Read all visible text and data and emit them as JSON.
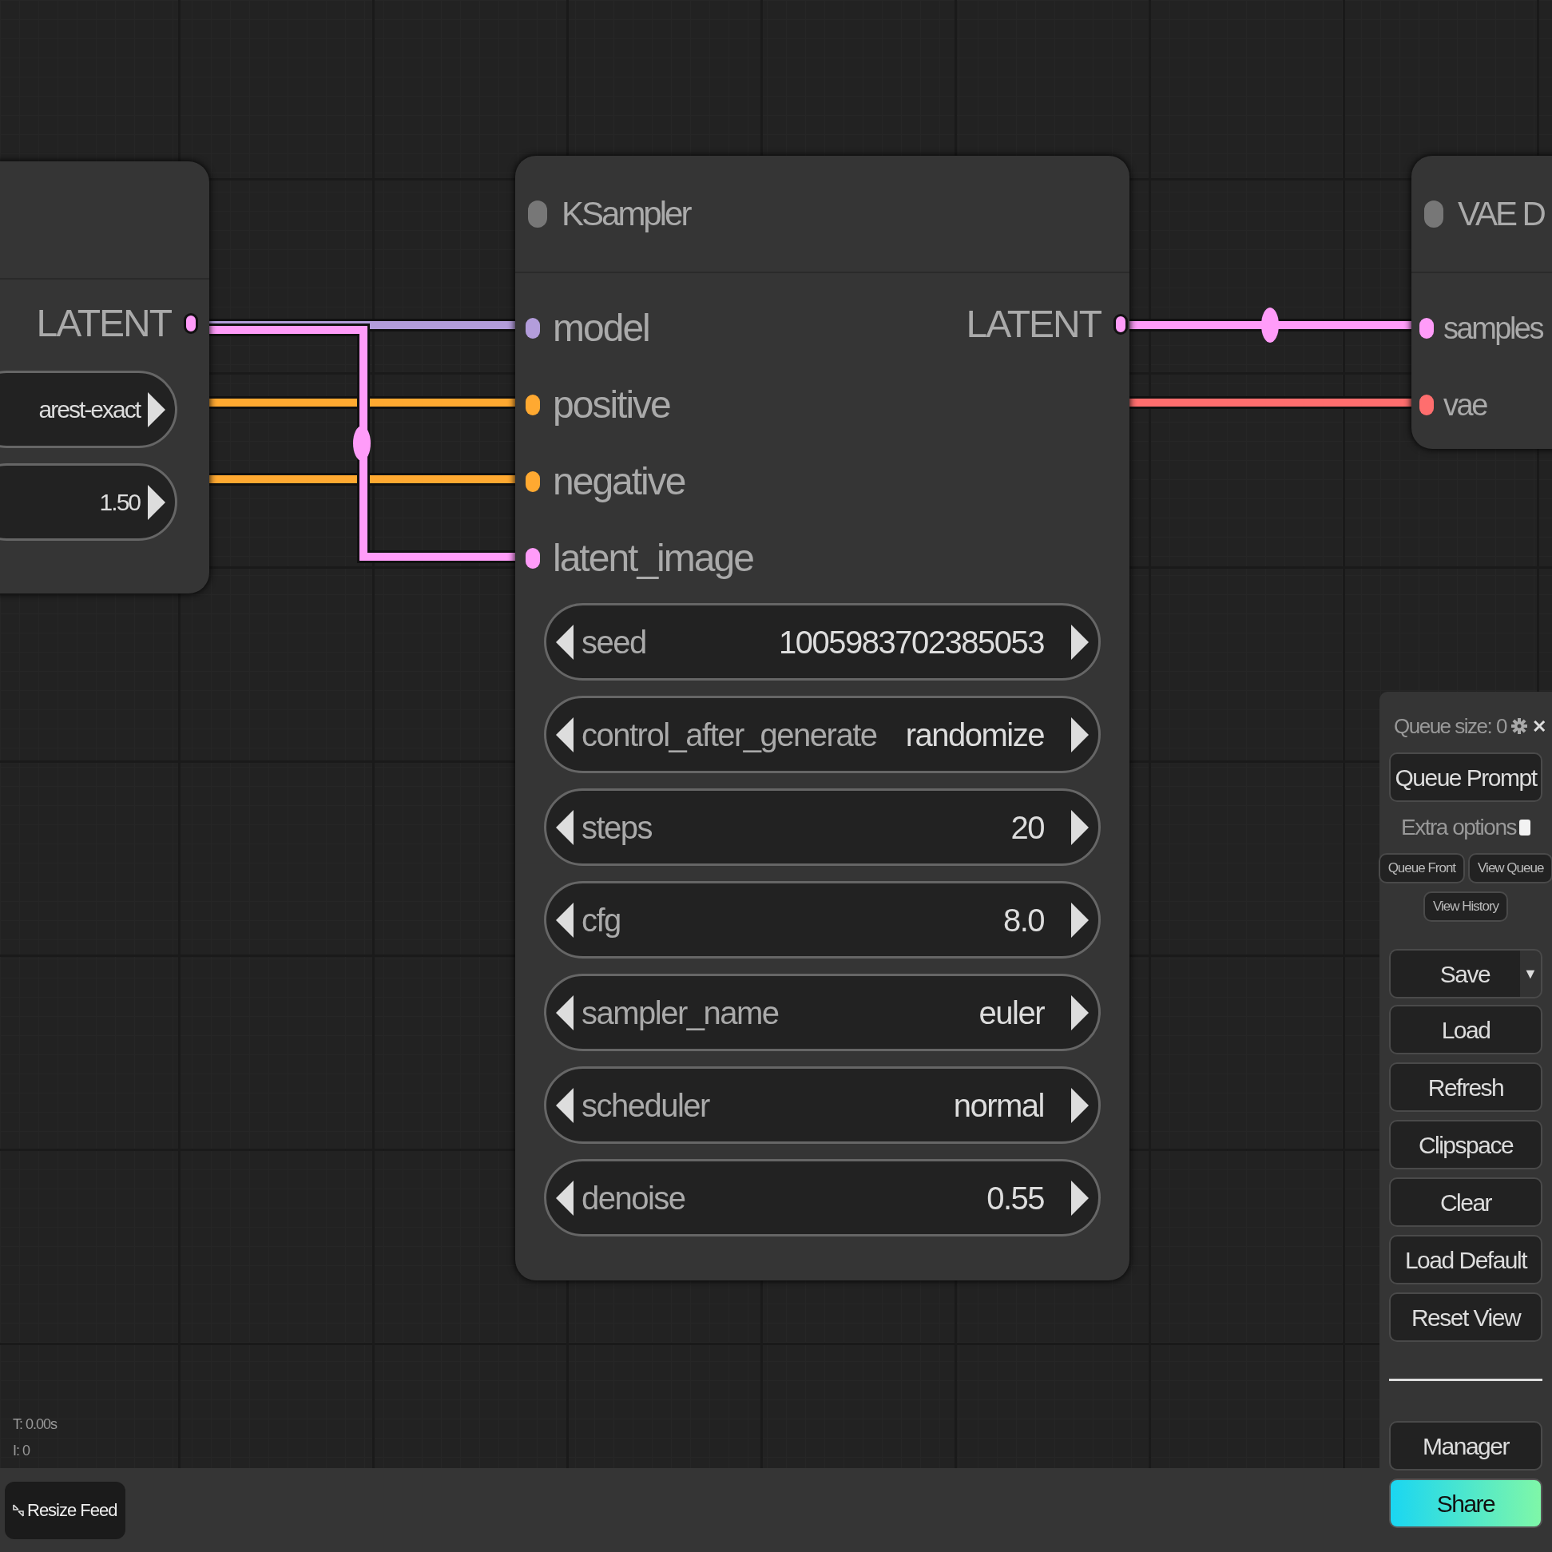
{
  "left_node": {
    "outputs": [
      {
        "label": "LATENT",
        "color": "#ff9cf9"
      }
    ],
    "widgets": [
      {
        "value": "arest-exact"
      },
      {
        "value": "1.50"
      }
    ]
  },
  "ksampler": {
    "title": "KSampler",
    "inputs": [
      {
        "label": "model",
        "color": "#b39ddb"
      },
      {
        "label": "positive",
        "color": "#ffa931"
      },
      {
        "label": "negative",
        "color": "#ffa931"
      },
      {
        "label": "latent_image",
        "color": "#ff9cf9"
      }
    ],
    "outputs": [
      {
        "label": "LATENT",
        "color": "#ff9cf9"
      }
    ],
    "widgets": [
      {
        "name": "seed",
        "value": "1005983702385053"
      },
      {
        "name": "control_after_generate",
        "value": "randomize"
      },
      {
        "name": "steps",
        "value": "20"
      },
      {
        "name": "cfg",
        "value": "8.0"
      },
      {
        "name": "sampler_name",
        "value": "euler"
      },
      {
        "name": "scheduler",
        "value": "normal"
      },
      {
        "name": "denoise",
        "value": "0.55"
      }
    ]
  },
  "vae_node": {
    "title": "VAE D",
    "inputs": [
      {
        "label": "samples",
        "color": "#ff9cf9"
      },
      {
        "label": "vae",
        "color": "#ff6e6e"
      }
    ]
  },
  "stats": [
    "T: 0.00s",
    "I: 0"
  ],
  "footer": {
    "resize_button": "Resize Feed"
  },
  "queue_panel": {
    "queue_size": "Queue size: 0",
    "close": "✕",
    "queue_prompt": "Queue Prompt",
    "extra_options": {
      "label": "Extra options",
      "checked": false
    },
    "small_buttons": [
      "Queue Front",
      "View Queue",
      "View History"
    ],
    "save": {
      "label": "Save",
      "menu": "▼"
    },
    "buttons": [
      "Load",
      "Refresh",
      "Clipspace",
      "Clear",
      "Load Default",
      "Reset View"
    ],
    "manager": "Manager",
    "share": "Share"
  }
}
